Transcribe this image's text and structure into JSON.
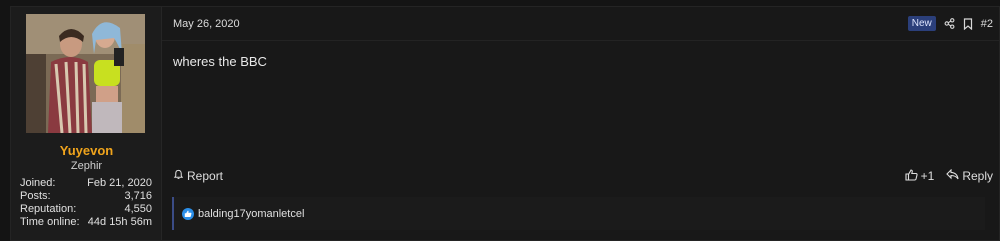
{
  "user": {
    "name": "Yuyevon",
    "title": "Zephir",
    "stats": [
      {
        "label": "Joined:",
        "value": "Feb 21, 2020"
      },
      {
        "label": "Posts:",
        "value": "3,716"
      },
      {
        "label": "Reputation:",
        "value": "4,550"
      },
      {
        "label": "Time online:",
        "value": "44d 15h 56m"
      }
    ]
  },
  "post": {
    "date": "May 26, 2020",
    "badge": "New",
    "number": "#2",
    "body": "wheres the BBC",
    "report_label": "Report",
    "like_count": "+1",
    "reply_label": "Reply"
  },
  "reactions": {
    "users": "balding17yomanletcel"
  },
  "colors": {
    "username": "#f0a41c",
    "badge_bg": "#2b3f7a",
    "like": "#2b8fe9"
  }
}
